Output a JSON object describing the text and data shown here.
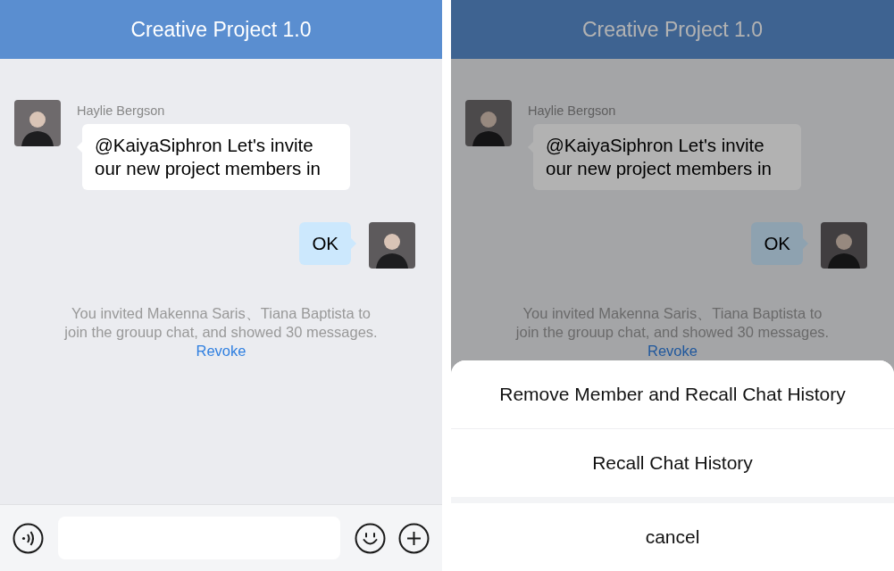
{
  "screens": [
    {
      "title": "Creative Project 1.0",
      "dimmed": false,
      "messages": [
        {
          "kind": "received",
          "sender": "Haylie Bergson",
          "text": "@KaiyaSiphron Let's invite our new project members in"
        },
        {
          "kind": "sent",
          "text": "OK"
        }
      ],
      "notice": {
        "text": "You invited Makenna Saris、Tiana Baptista to join the grouup chat, and showed 30 messages.",
        "link": "Revoke"
      },
      "input_bar": true
    },
    {
      "title": "Creative Project 1.0",
      "dimmed": true,
      "messages": [
        {
          "kind": "received",
          "sender": "Haylie Bergson",
          "text": "@KaiyaSiphron Let's invite our new project members in"
        },
        {
          "kind": "sent",
          "text": "OK"
        }
      ],
      "notice": {
        "text": "You invited Makenna Saris、Tiana Baptista to join the grouup chat, and showed 30 messages.",
        "link": "Revoke"
      },
      "action_sheet": {
        "options": [
          "Remove Member and Recall Chat History",
          "Recall Chat History"
        ],
        "cancel": "cancel"
      }
    }
  ]
}
